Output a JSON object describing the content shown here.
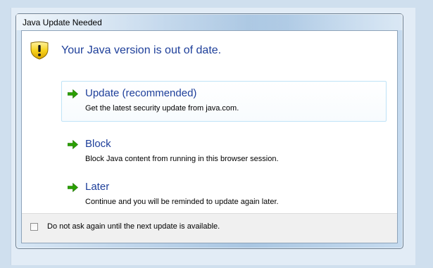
{
  "dialog": {
    "title": "Java Update Needed",
    "headline": "Your Java version is out of date.",
    "icon": "warning-shield-icon"
  },
  "options": [
    {
      "title": "Update (recommended)",
      "description": "Get the latest security update from java.com.",
      "icon": "green-arrow-icon",
      "highlighted": true
    },
    {
      "title": "Block",
      "description": "Block Java content from running in this browser session.",
      "icon": "green-arrow-icon",
      "highlighted": false
    },
    {
      "title": "Later",
      "description": "Continue and you will be reminded to update again later.",
      "icon": "green-arrow-icon",
      "highlighted": false
    }
  ],
  "footer": {
    "checkbox_label": "Do not ask again until the next update is available.",
    "checked": false
  },
  "colors": {
    "link_blue": "#1e3f9a",
    "arrow_green": "#2aa000",
    "warning_yellow": "#f5c800"
  }
}
